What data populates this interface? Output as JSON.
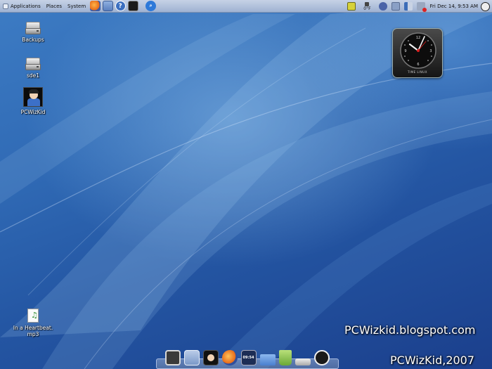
{
  "top_panel": {
    "menus": [
      "Applications",
      "Places",
      "System"
    ],
    "launchers": [
      {
        "icon": "firefox-icon",
        "color": "#e66a1a"
      },
      {
        "icon": "mail-icon",
        "color": "#5a7fbf"
      },
      {
        "icon": "help-icon",
        "color": "#3b6fc0"
      },
      {
        "icon": "terminal-icon",
        "color": "#1b1b1b"
      },
      {
        "icon": "search-icon",
        "color": "#2d79d9"
      }
    ],
    "weather": {
      "temperature": "0°F"
    },
    "clock": "Fri Dec 14,  9:53 AM"
  },
  "desktop_icons": [
    {
      "label": "Backups",
      "icon": "hard-drive-icon"
    },
    {
      "label": "sde1",
      "icon": "hard-drive-icon"
    },
    {
      "label": "PCWizKid",
      "icon": "user-avatar-icon"
    },
    {
      "label": "In a Heartbeat.\nmp3",
      "icon": "audio-file-icon"
    }
  ],
  "clock_widget": {
    "caption": "TIME LINUX"
  },
  "watermarks": {
    "blog": "PCWizkid.blogspot.com",
    "credit": "PCWizKid,2007"
  },
  "dock": {
    "items": [
      {
        "icon": "monitor-icon",
        "color": "#3a3a3a"
      },
      {
        "icon": "mail-stamp-icon",
        "color": "#7a98c8"
      },
      {
        "icon": "user-avatar-icon",
        "color": "#111111"
      },
      {
        "icon": "firefox-icon",
        "color": "#e66a1a"
      },
      {
        "icon": "calendar-clock-icon",
        "color": "#1d2d55",
        "text": "09:54"
      },
      {
        "icon": "folder-icon",
        "color": "#5c8fd8"
      },
      {
        "icon": "trash-icon",
        "color": "#7fc04a"
      },
      {
        "icon": "drive-icon",
        "color": "#c9c9c9"
      },
      {
        "icon": "power-icon",
        "color": "#1a1a1a"
      }
    ]
  }
}
